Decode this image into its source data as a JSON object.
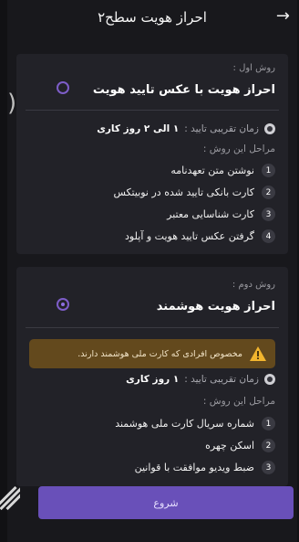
{
  "header": {
    "title": "احراز هویت سطح۲"
  },
  "method1": {
    "label": "روش اول :",
    "title": "احراز هویت با عکس تایید هویت",
    "time_label": "زمان تقریبی تایید :",
    "time_value": "۱ الی ۲ روز کاری",
    "steps_label": "مراحل این روش :",
    "steps": [
      {
        "num": "1",
        "text": "نوشتن متن تعهدنامه"
      },
      {
        "num": "2",
        "text": "کارت بانکی تایید شده در نوبیتکس"
      },
      {
        "num": "3",
        "text": "کارت شناسایی معتبر"
      },
      {
        "num": "4",
        "text": "گرفتن عکس تایید هویت و آپلود"
      }
    ]
  },
  "method2": {
    "label": "روش دوم :",
    "title": "احراز هویت هوشمند",
    "warning": "مخصوص افرادی که کارت ملی هوشمند دارند.",
    "time_label": "زمان تقریبی تایید :",
    "time_value": "۱ روز کاری",
    "steps_label": "مراحل این روش :",
    "steps": [
      {
        "num": "1",
        "text": "شماره سریال کارت ملی هوشمند"
      },
      {
        "num": "2",
        "text": "اسکن چهره"
      },
      {
        "num": "3",
        "text": "ضبط ویدیو موافقت با قوانین"
      }
    ]
  },
  "actions": {
    "start": "شروع"
  },
  "colors": {
    "accent": "#6950b9",
    "warning_bg": "#63491d",
    "card_bg": "#222228"
  }
}
